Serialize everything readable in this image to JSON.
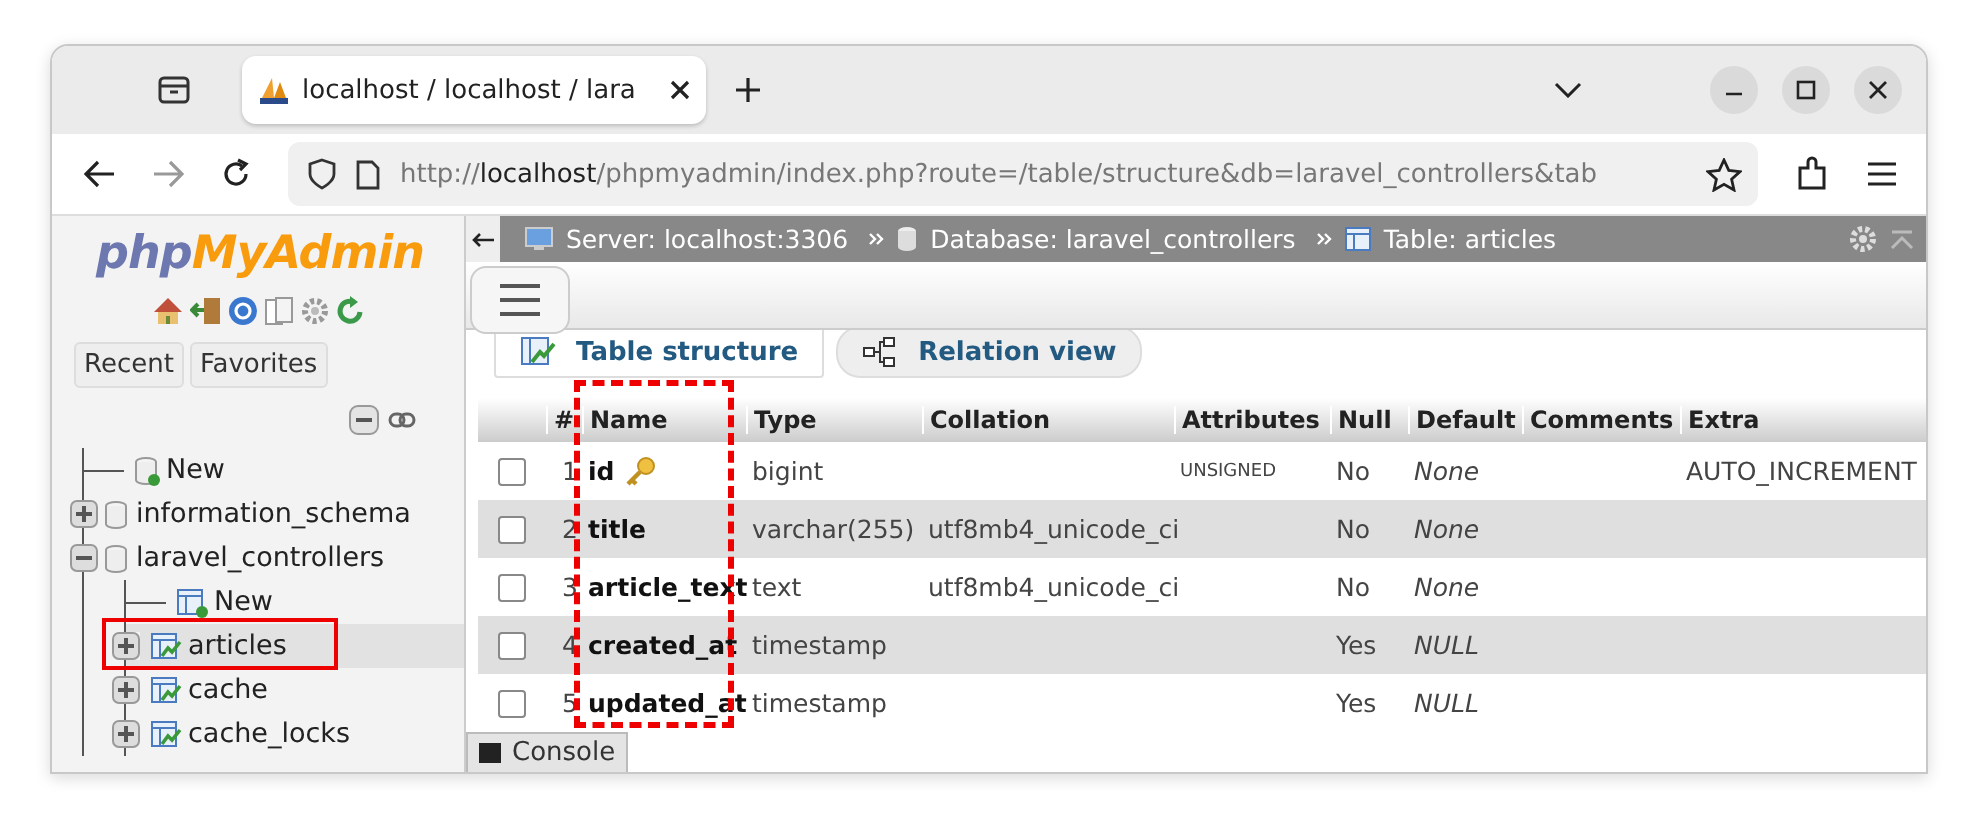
{
  "browser": {
    "tab": {
      "title": "localhost / localhost / lara"
    },
    "address": {
      "scheme": "http://",
      "host": "localhost",
      "path": "/phpmyadmin/index.php?route=/table/structure&db=laravel_controllers&tab"
    }
  },
  "sidebar": {
    "logo": {
      "part1": "php",
      "part2": "MyAdmin"
    },
    "buttons": [
      "Recent",
      "Favorites"
    ],
    "tree": [
      {
        "label": "New",
        "kind": "new"
      },
      {
        "label": "information_schema",
        "kind": "db",
        "expanded": false
      },
      {
        "label": "laravel_controllers",
        "kind": "db",
        "expanded": true,
        "children": [
          {
            "label": "New",
            "kind": "new-table"
          },
          {
            "label": "articles",
            "kind": "table",
            "expanded": false,
            "highlighted": true
          },
          {
            "label": "cache",
            "kind": "table",
            "expanded": false,
            "highlighted": false
          },
          {
            "label": "cache_locks",
            "kind": "table",
            "expanded": false,
            "highlighted": false
          }
        ]
      }
    ]
  },
  "breadcrumb": [
    {
      "label": "Server: localhost:3306",
      "kind": "server"
    },
    {
      "label": "Database: laravel_controllers",
      "kind": "database"
    },
    {
      "label": "Table: articles",
      "kind": "table"
    }
  ],
  "tabs": [
    {
      "label": "Table structure",
      "selected": true
    },
    {
      "label": "Relation view",
      "selected": false
    }
  ],
  "table": {
    "columns": [
      {
        "label": "#",
        "highlighted": false
      },
      {
        "label": "Name",
        "highlighted": true
      },
      {
        "label": "Type",
        "highlighted": false
      },
      {
        "label": "Collation",
        "highlighted": false
      },
      {
        "label": "Attributes",
        "highlighted": false
      },
      {
        "label": "Null",
        "highlighted": false
      },
      {
        "label": "Default",
        "highlighted": false
      },
      {
        "label": "Comments",
        "highlighted": false
      },
      {
        "label": "Extra",
        "highlighted": false
      }
    ],
    "rows": [
      {
        "checked": false,
        "number": "1",
        "name": "id",
        "primary_key": true,
        "type": "bigint",
        "attributes": "UNSIGNED",
        "null": "No",
        "default": "None",
        "extra": "AUTO_INCREMENT"
      },
      {
        "checked": false,
        "number": "2",
        "name": "title",
        "primary_key": false,
        "type": "varchar(255)",
        "collation": "utf8mb4_unicode_ci",
        "null": "No",
        "default": "None"
      },
      {
        "checked": false,
        "number": "3",
        "name": "article_text",
        "primary_key": false,
        "type": "text",
        "collation": "utf8mb4_unicode_ci",
        "null": "No",
        "default": "None"
      },
      {
        "checked": false,
        "number": "4",
        "name": "created_at",
        "primary_key": false,
        "type": "timestamp",
        "null": "Yes",
        "default": "NULL"
      },
      {
        "checked": false,
        "number": "5",
        "name": "updated_at",
        "primary_key": false,
        "type": "timestamp",
        "null": "Yes",
        "default": "NULL"
      }
    ]
  },
  "console": {
    "label": "Console"
  }
}
